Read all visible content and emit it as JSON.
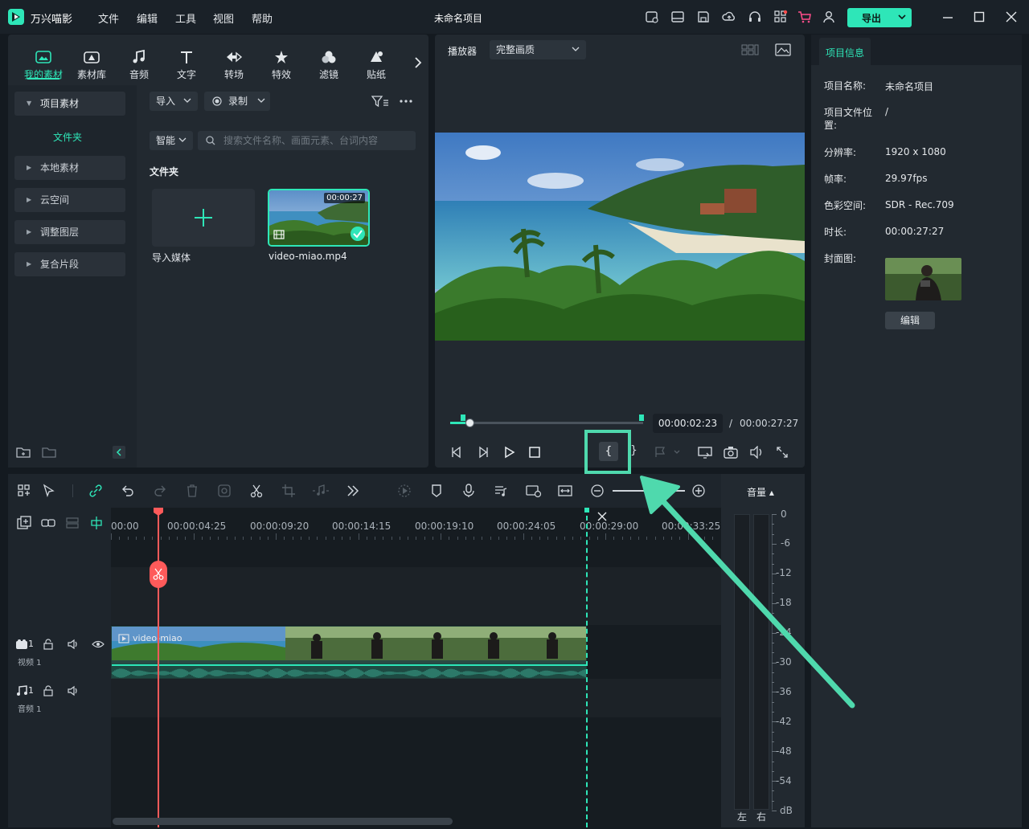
{
  "app": {
    "name": "万兴喵影",
    "project_title": "未命名项目"
  },
  "menu": [
    "文件",
    "编辑",
    "工具",
    "视图",
    "帮助"
  ],
  "export": {
    "label": "导出"
  },
  "media_tabs": [
    {
      "label": "我的素材",
      "icon": "my-media-icon"
    },
    {
      "label": "素材库",
      "icon": "library-icon"
    },
    {
      "label": "音频",
      "icon": "music-note-icon"
    },
    {
      "label": "文字",
      "icon": "text-icon"
    },
    {
      "label": "转场",
      "icon": "transition-icon"
    },
    {
      "label": "特效",
      "icon": "effects-icon"
    },
    {
      "label": "滤镜",
      "icon": "filter-icon"
    },
    {
      "label": "贴纸",
      "icon": "sticker-icon"
    }
  ],
  "sidebar": {
    "project_media": "项目素材",
    "folder": "文件夹",
    "items": [
      "本地素材",
      "云空间",
      "调整图层",
      "复合片段"
    ]
  },
  "media_toolbar": {
    "import": "导入",
    "record": "录制"
  },
  "search": {
    "mode": "智能",
    "placeholder": "搜索文件名称、画面元素、台词内容"
  },
  "folder_heading": "文件夹",
  "media_items": {
    "import_label": "导入媒体",
    "clip_name": "video-miao.mp4",
    "clip_duration": "00:00:27"
  },
  "player": {
    "label": "播放器",
    "quality": "完整画质",
    "current_time": "00:00:02:23",
    "separator": "/",
    "total_time": "00:00:27:27",
    "progress": 0.1
  },
  "project_info": {
    "tab": "项目信息",
    "fields": [
      {
        "label": "项目名称:",
        "value": "未命名项目"
      },
      {
        "label": "项目文件位置:",
        "value": "/"
      },
      {
        "label": "分辨率:",
        "value": "1920 x 1080"
      },
      {
        "label": "帧率:",
        "value": "29.97fps"
      },
      {
        "label": "色彩空间:",
        "value": "SDR - Rec.709"
      },
      {
        "label": "时长:",
        "value": "00:00:27:27"
      },
      {
        "label": "封面图:",
        "value": ""
      }
    ],
    "edit_button": "编辑"
  },
  "timeline": {
    "ruler": [
      "00:00",
      "00:00:04:25",
      "00:00:09:20",
      "00:00:14:15",
      "00:00:19:10",
      "00:00:24:05",
      "00:00:29:00",
      "00:00:33:25"
    ],
    "video_track": {
      "index": "1",
      "name": "视频 1"
    },
    "audio_track": {
      "index": "1",
      "name": "音频 1"
    },
    "clip_label": "video-miao"
  },
  "volume_meter": {
    "title": "音量",
    "scale": [
      "0",
      "-6",
      "-12",
      "-18",
      "-24",
      "-30",
      "-36",
      "-42",
      "-48",
      "-54",
      "dB"
    ],
    "left": "左",
    "right": "右"
  },
  "colors": {
    "accent": "#2ee6b8",
    "playhead": "#ff5a5a",
    "panel": "#222930",
    "background": "#141a20"
  }
}
